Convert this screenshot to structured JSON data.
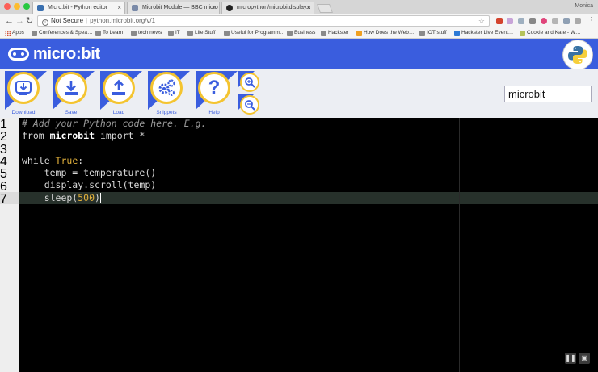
{
  "browser": {
    "tabs": [
      {
        "label": "Micro:bit - Python editor",
        "active": true
      },
      {
        "label": "Microbit Module — BBC micro",
        "active": false
      },
      {
        "label": "micropython/microbitdisplay.c",
        "active": false
      }
    ],
    "profile": "Monica",
    "address": {
      "security": "Not Secure",
      "url": "python.microbit.org/v/1"
    },
    "bookmarks": [
      "Apps",
      "Conferences & Spea…",
      "To Learn",
      "tech news",
      "IT",
      "Life Stuff",
      "Useful for Programm…",
      "Business",
      "Hackster",
      "How Does the Web…",
      "IOT stuff",
      "Hackster Live Event…",
      "Cookie and Kate - W…"
    ]
  },
  "app": {
    "logo_text": "micro:bit",
    "toolbar": [
      {
        "label": "Download",
        "icon": "download-icon"
      },
      {
        "label": "Save",
        "icon": "save-icon"
      },
      {
        "label": "Load",
        "icon": "load-icon"
      },
      {
        "label": "Snippets",
        "icon": "snippets-icon"
      },
      {
        "label": "Help",
        "icon": "help-icon"
      }
    ],
    "zoom": [
      "zoom-in-icon",
      "zoom-out-icon"
    ],
    "script_name": "microbit"
  },
  "editor": {
    "line_numbers": [
      "1",
      "2",
      "3",
      "4",
      "5",
      "6",
      "7"
    ],
    "active_line": 7,
    "lines": [
      [
        {
          "t": "comment",
          "s": "# Add your Python code here. E.g."
        }
      ],
      [
        {
          "t": "kw",
          "s": "from "
        },
        {
          "t": "mod",
          "s": "microbit"
        },
        {
          "t": "kw",
          "s": " import *"
        }
      ],
      [],
      [
        {
          "t": "kw",
          "s": "while "
        },
        {
          "t": "const",
          "s": "True"
        },
        {
          "t": "kw",
          "s": ":"
        }
      ],
      [
        {
          "t": "kw",
          "s": "    temp = temperature()"
        }
      ],
      [
        {
          "t": "kw",
          "s": "    display.scroll(temp)"
        }
      ],
      [
        {
          "t": "kw",
          "s": "    sleep("
        },
        {
          "t": "num",
          "s": "500"
        },
        {
          "t": "kw",
          "s": ")"
        }
      ]
    ]
  },
  "colors": {
    "brand_blue": "#3a5dde",
    "accent_yellow": "#f4c430"
  }
}
